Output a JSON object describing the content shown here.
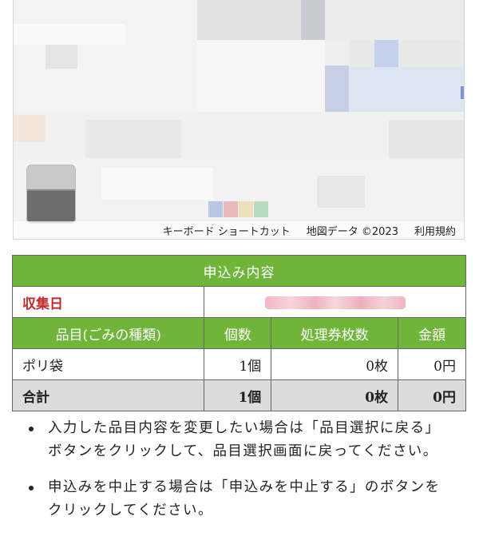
{
  "map": {
    "shortcut_label": "キーボード ショートカット",
    "data_label": "地図データ ©2023",
    "terms_label": "利用規約"
  },
  "application": {
    "title": "申込み内容",
    "collection_date_label": "収集日",
    "columns": [
      "品目(ごみの種類)",
      "個数",
      "処理券枚数",
      "金額"
    ],
    "rows": [
      {
        "item": "ポリ袋",
        "count": "1個",
        "tickets": "0枚",
        "amount": "0円"
      }
    ],
    "total": {
      "label": "合計",
      "count": "1個",
      "tickets": "0枚",
      "amount": "0円"
    }
  },
  "notes": [
    "入力した品目内容を変更したい場合は「品目選択に戻る」ボタンをクリックして、品目選択画面に戻ってください。",
    "申込みを中止する場合は「申込みを中止する」のボタンをクリックしてください。"
  ],
  "colors": {
    "header_green": "#6fb53a",
    "date_label_red": "#c32a2a",
    "total_row_gray": "#dcdcdc"
  }
}
